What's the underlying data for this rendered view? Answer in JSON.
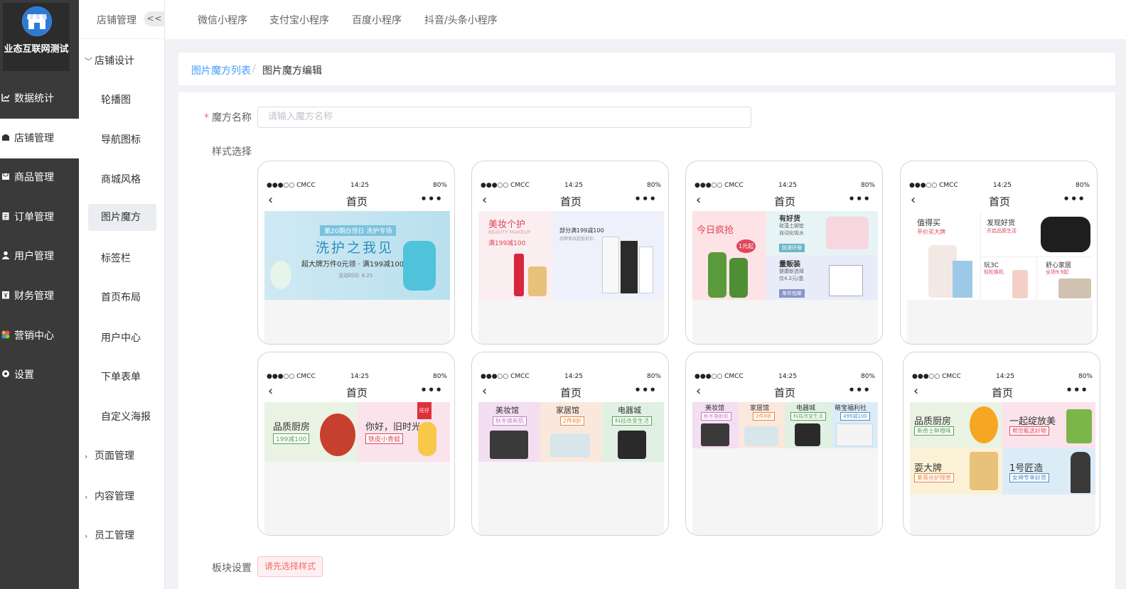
{
  "app": {
    "name": "业态互联网测试"
  },
  "sidebar": {
    "items": [
      {
        "label": "数据统计",
        "icon": "chart-icon"
      },
      {
        "label": "店铺管理",
        "icon": "store-icon",
        "active": true
      },
      {
        "label": "商品管理",
        "icon": "goods-icon"
      },
      {
        "label": "订单管理",
        "icon": "order-icon"
      },
      {
        "label": "用户管理",
        "icon": "user-icon"
      },
      {
        "label": "财务管理",
        "icon": "finance-icon"
      },
      {
        "label": "营销中心",
        "icon": "marketing-icon"
      },
      {
        "label": "设置",
        "icon": "gear-icon"
      }
    ]
  },
  "subnav": {
    "title": "店铺管理",
    "collapse": "<<",
    "group_design": "店铺设计",
    "items": [
      "轮播图",
      "导航图标",
      "商城风格",
      "图片魔方",
      "标签栏",
      "首页布局",
      "用户中心",
      "下单表单",
      "自定义海报"
    ],
    "groups_collapsed": [
      "页面管理",
      "内容管理",
      "员工管理"
    ]
  },
  "top_tabs": [
    "微信小程序",
    "支付宝小程序",
    "百度小程序",
    "抖音/头条小程序"
  ],
  "breadcrumb": {
    "list": "图片魔方列表",
    "sep": "/",
    "current": "图片魔方编辑"
  },
  "form": {
    "name_label": "魔方名称",
    "name_placeholder": "请输入魔方名称",
    "style_label": "样式选择",
    "block_label": "板块设置",
    "block_button": "请先选择样式"
  },
  "phone": {
    "carrier": "●●●○○ CMCC",
    "time": "14:25",
    "battery": "80%",
    "title": "首页",
    "back": "‹",
    "more": "•••"
  },
  "templates": {
    "t1": {
      "top": "第20期白领日 洗护专场",
      "title": "洗护之我见",
      "sub": "超大牌万件0元领 · 满199减100",
      "small": "活动时间: 8.25"
    },
    "t2": {
      "title": "美妆个护",
      "en": "BEAUTY MAKEUP",
      "promo": "满199减100",
      "promo2": "部分满199减100",
      "sub2": "品牌美妆超低折扣"
    },
    "t3": {
      "title": "今日疯抢",
      "badge": "1元起",
      "c1_title": "有好货",
      "c1_sub": "硅藻土脚垫\n自动化吸水",
      "c1_tag": "防滑环保",
      "c2_title": "量贩装",
      "c2_sub": "健康新选择\n仅4.2元/盒",
      "c2_tag": "单件包邮"
    },
    "t4": {
      "c1_title": "值得买",
      "c1_sub": "平价买大牌",
      "c2_title": "发现好货",
      "c2_sub": "开启品质生活",
      "c3_title": "玩3C",
      "c3_sub": "轻松换机",
      "c4_title": "舒心家居",
      "c4_sub": "全场9.9起"
    },
    "t5": {
      "c1_title": "品质厨房",
      "c1_tag": "199减100",
      "c2_title": "你好，旧时光",
      "c2_tag": "铁皮小青蛙",
      "c2_brand": "旺仔"
    },
    "t6": {
      "c1_title": "美妆馆",
      "c1_tag": "秋冬换新肌",
      "c2_title": "家居馆",
      "c2_tag": "2件8折",
      "c3_title": "电器城",
      "c3_tag": "科技改变生活"
    },
    "t7": {
      "c1_title": "美妆馆",
      "c1_tag": "秋冬换新肌",
      "c2_title": "家居馆",
      "c2_tag": "2件8折",
      "c3_title": "电器城",
      "c3_tag": "科技改变生活",
      "c4_title": "萌宝福利社",
      "c4_tag": "499减100"
    },
    "t8": {
      "c1_title": "品质厨房",
      "c1_tag": "新奇士鲜橙味",
      "c2_title": "一起绽放美",
      "c2_tag": "帮您甄选好物",
      "c3_title": "耍大牌",
      "c3_tag": "莱蒂丝护理草",
      "c4_title": "1号匠造",
      "c4_tag": "女神专享好货"
    }
  },
  "colors": {
    "sidebar_bg": "#3a3a3a",
    "link": "#409eff",
    "danger": "#f56c6c",
    "tag_green": "#5aa05a",
    "tag_red": "#e0455a"
  }
}
